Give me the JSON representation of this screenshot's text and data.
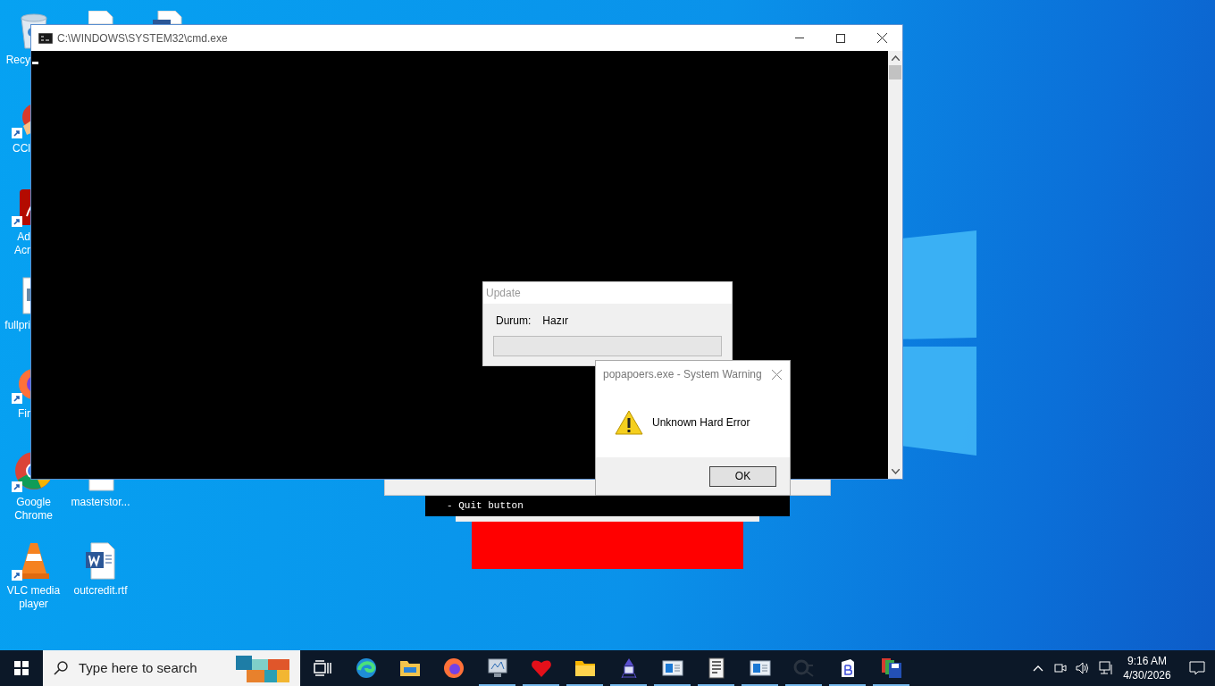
{
  "desktop_icons": [
    {
      "kind": "recycle-bin",
      "label": "Recy",
      "shortcut": false
    },
    {
      "kind": "ccleaner",
      "label": "CCl",
      "shortcut": true
    },
    {
      "kind": "acrobat",
      "label": "Ad\nAcr",
      "shortcut": true
    },
    {
      "kind": "image-file",
      "label": "fullpri",
      "shortcut": false
    },
    {
      "kind": "firefox",
      "label": "Fir",
      "shortcut": true
    },
    {
      "kind": "chrome",
      "label": "Google\nChrome",
      "shortcut": true
    },
    {
      "kind": "vlc",
      "label": "VLC media\nplayer",
      "shortcut": true
    },
    {
      "kind": "document",
      "shortcut": false
    },
    {
      "kind": "document",
      "label": "masterstor...",
      "shortcut": false
    },
    {
      "kind": "word-doc",
      "label": "outcredit.rtf",
      "shortcut": false
    },
    {
      "kind": "word-doc",
      "shortcut": false
    }
  ],
  "cmd_window": {
    "title": "C:\\WINDOWS\\SYSTEM32\\cmd.exe"
  },
  "update_dialog": {
    "title": "Update",
    "status_label": "Durum:",
    "status_value": "Hazır",
    "progress": {
      "level": 0
    }
  },
  "background_window": {
    "line": "- Quit button"
  },
  "warning_dialog": {
    "title": "popapoers.exe - System Warning",
    "message": "Unknown Hard Error",
    "button": "OK"
  },
  "taskbar": {
    "search": {
      "placeholder": "Type here to search"
    },
    "apps": [
      {
        "kind": "task-view",
        "running": false
      },
      {
        "kind": "edge",
        "running": false
      },
      {
        "kind": "folder",
        "running": false
      },
      {
        "kind": "firefox",
        "running": false
      },
      {
        "kind": "monitor",
        "running": true
      },
      {
        "kind": "heart",
        "running": true
      },
      {
        "kind": "folder-yellow",
        "running": true
      },
      {
        "kind": "wizard",
        "running": true
      },
      {
        "kind": "window-app",
        "running": true
      },
      {
        "kind": "notepad",
        "running": true
      },
      {
        "kind": "window-app",
        "running": true
      },
      {
        "kind": "qt",
        "running": true
      },
      {
        "kind": "b-app",
        "running": true
      },
      {
        "kind": "floppy",
        "running": true
      }
    ],
    "clock": {
      "time": "9:16 AM",
      "date": "4/30/2026"
    }
  }
}
